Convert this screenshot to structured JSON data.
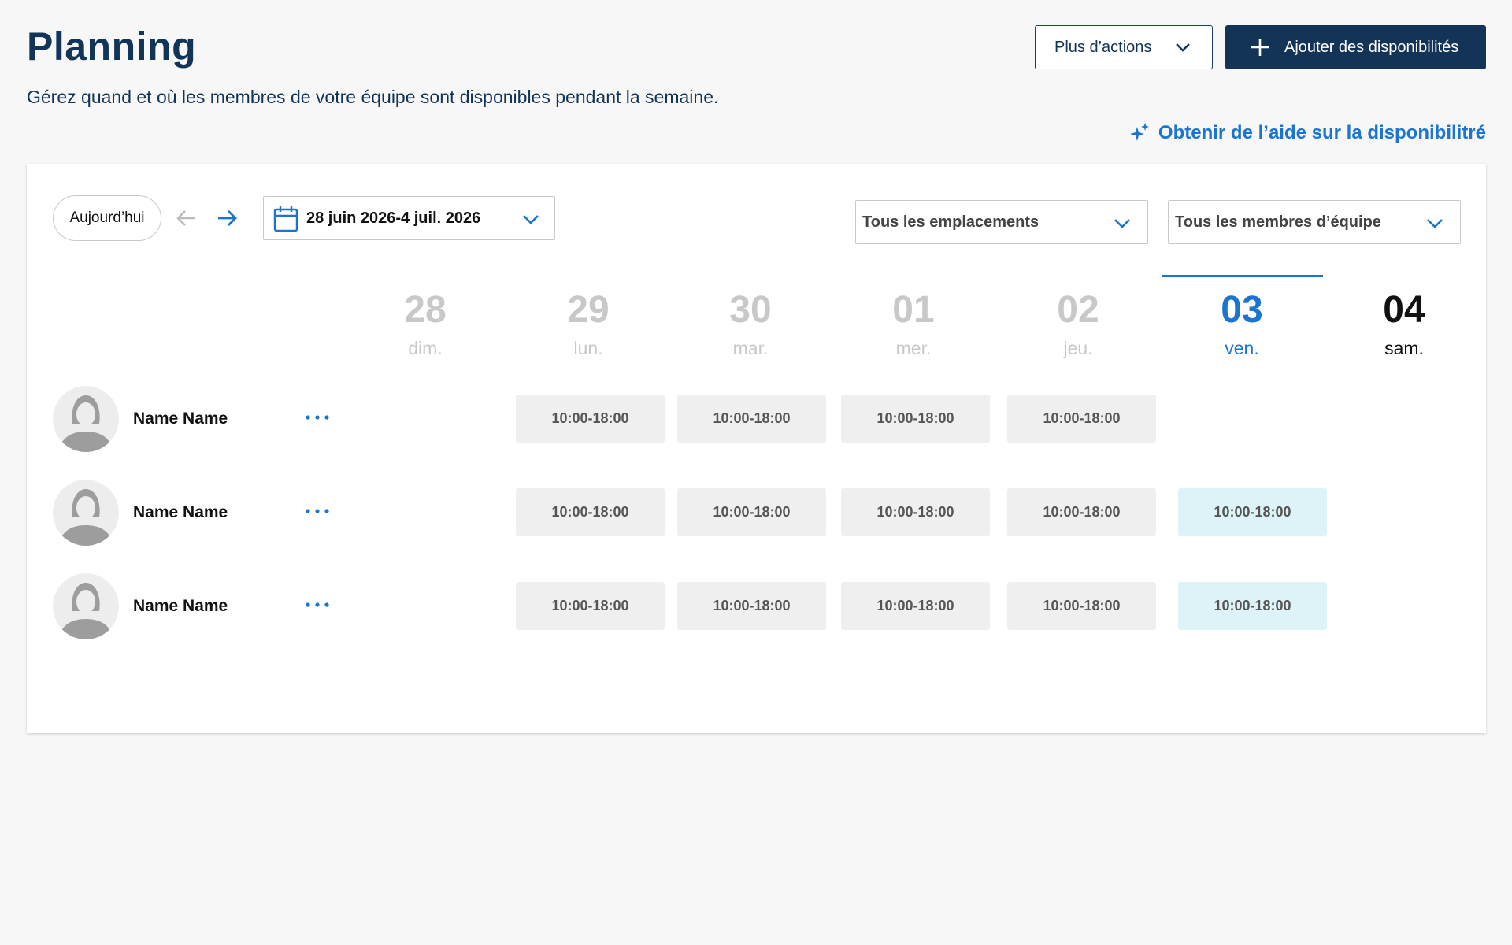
{
  "header": {
    "title": "Planning",
    "subtitle": "Gérez quand et où les membres de votre équipe sont disponibles pendant la semaine.",
    "more_actions_label": "Plus d’actions",
    "add_label": "Ajouter des disponibilités",
    "help_link": "Obtenir de l’aide sur la disponibilitré"
  },
  "toolbar": {
    "today_label": "Aujourd’hui",
    "date_range": "28 juin 2026-4 juil. 2026",
    "location_filter": "Tous les emplacements",
    "team_filter": "Tous les membres d’équipe"
  },
  "days": [
    {
      "num": "28",
      "name": "dim."
    },
    {
      "num": "29",
      "name": "lun."
    },
    {
      "num": "30",
      "name": "mar."
    },
    {
      "num": "01",
      "name": "mer."
    },
    {
      "num": "02",
      "name": "jeu."
    },
    {
      "num": "03",
      "name": "ven."
    },
    {
      "num": "04",
      "name": "sam."
    }
  ],
  "members": [
    {
      "name": "Name Name",
      "slots": [
        "10:00-18:00",
        "10:00-18:00",
        "10:00-18:00",
        "10:00-18:00"
      ]
    },
    {
      "name": "Name Name",
      "slots": [
        "10:00-18:00",
        "10:00-18:00",
        "10:00-18:00",
        "10:00-18:00",
        "10:00-18:00"
      ]
    },
    {
      "name": "Name Name",
      "slots": [
        "10:00-18:00",
        "10:00-18:00",
        "10:00-18:00",
        "10:00-18:00",
        "10:00-18:00"
      ]
    }
  ],
  "colors": {
    "accent": "#1b75d0",
    "primary_dark": "#143457",
    "slot_default": "#efefef",
    "slot_highlight": "#def3f8"
  }
}
